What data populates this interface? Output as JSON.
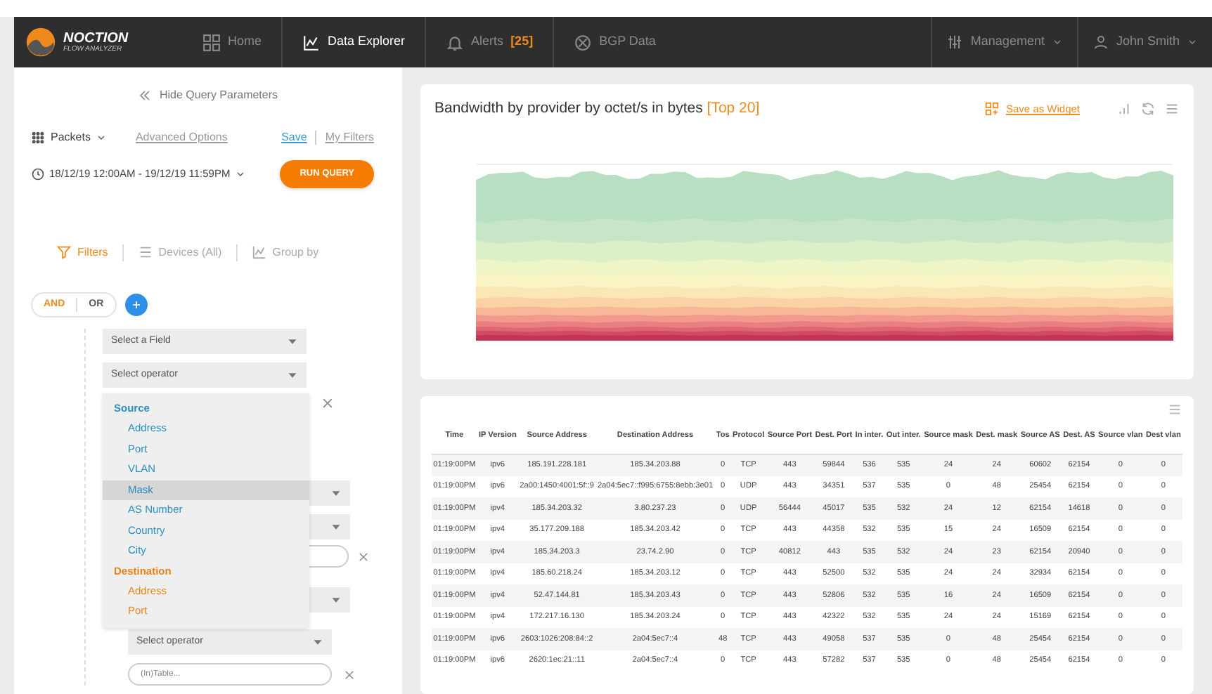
{
  "navbar": {
    "logo": {
      "name": "NOCTION",
      "subtitle": "FLOW ANALYZER"
    },
    "items": [
      {
        "label": "Home",
        "selected": false
      },
      {
        "label": "Data Explorer",
        "selected": true
      },
      {
        "label": "Alerts",
        "badge": "[25]",
        "selected": false
      },
      {
        "label": "BGP Data",
        "selected": false
      }
    ],
    "right": [
      {
        "label": "Management"
      },
      {
        "label": "John Smith"
      }
    ]
  },
  "query": {
    "hide_link": "Hide Query Parameters",
    "metric": "Packets",
    "advanced": "Advanced Options",
    "save": "Save",
    "my_filters": "My Filters",
    "range": "18/12/19 12:00AM - 19/12/19 11:59PM",
    "run": "RUN QUERY",
    "tabs": [
      {
        "label": "Filters",
        "selected": true
      },
      {
        "label": "Devices (All)",
        "selected": false
      },
      {
        "label": "Group by",
        "selected": false
      }
    ],
    "logic": [
      {
        "label": "AND",
        "selected": true
      },
      {
        "label": "OR",
        "selected": false
      }
    ],
    "field_select": {
      "placeholder": "Select a Field"
    },
    "operator_select": {
      "placeholder": "Select operator"
    },
    "dropdown": [
      {
        "group": "Source",
        "items": [
          {
            "label": "Address",
            "selected": false
          },
          {
            "label": "Port",
            "selected": false
          },
          {
            "label": "VLAN",
            "selected": false
          },
          {
            "label": "Mask",
            "selected": true
          },
          {
            "label": "AS Number",
            "selected": false
          },
          {
            "label": "Country",
            "selected": false
          },
          {
            "label": "City",
            "selected": false
          }
        ]
      },
      {
        "group": "Destination",
        "items": [
          {
            "label": "Address",
            "selected": false
          },
          {
            "label": "Port",
            "selected": false
          }
        ]
      }
    ],
    "lower_operator": {
      "placeholder": "Select operator"
    },
    "lower_value": {
      "placeholder": "(In)Table..."
    }
  },
  "chart": {
    "title": "Bandwidth by provider by octet/s in bytes",
    "title_badge": "[Top 20]",
    "save_widget": "Save as Widget"
  },
  "table": {
    "columns": [
      "Time",
      "IP Version",
      "Source Address",
      "Destination Address",
      "Tos",
      "Protocol",
      "Source Port",
      "Dest. Port",
      "In inter.",
      "Out inter.",
      "Source mask",
      "Dest. mask",
      "Source AS",
      "Dest. AS",
      "Source vlan",
      "Dest vlan"
    ],
    "rows": [
      [
        "01:19:00PM",
        "ipv6",
        "185.191.228.181",
        "185.34.203.88",
        "0",
        "TCP",
        "443",
        "59844",
        "536",
        "535",
        "24",
        "24",
        "60602",
        "62154",
        "0",
        "0"
      ],
      [
        "01:19:00PM",
        "ipv6",
        "2a00:1450:4001:5f::9",
        "2a04:5ec7::f995:6755:8ebb:3e01",
        "0",
        "UDP",
        "443",
        "34351",
        "537",
        "535",
        "0",
        "48",
        "25454",
        "62154",
        "0",
        "0"
      ],
      [
        "01:19:00PM",
        "ipv4",
        "185.34.203.32",
        "3.80.237.23",
        "0",
        "UDP",
        "56444",
        "45017",
        "535",
        "532",
        "24",
        "12",
        "62154",
        "14618",
        "0",
        "0"
      ],
      [
        "01:19:00PM",
        "ipv4",
        "35.177.209.188",
        "185.34.203.42",
        "0",
        "TCP",
        "443",
        "44358",
        "532",
        "535",
        "15",
        "24",
        "16509",
        "62154",
        "0",
        "0"
      ],
      [
        "01:19:00PM",
        "ipv4",
        "185.34.203.3",
        "23.74.2.90",
        "0",
        "TCP",
        "40812",
        "443",
        "535",
        "532",
        "24",
        "23",
        "62154",
        "20940",
        "0",
        "0"
      ],
      [
        "01:19:00PM",
        "ipv4",
        "185.60.218.24",
        "185.34.203.12",
        "0",
        "TCP",
        "443",
        "52500",
        "532",
        "535",
        "24",
        "24",
        "32934",
        "62154",
        "0",
        "0"
      ],
      [
        "01:19:00PM",
        "ipv4",
        "52.47.144.81",
        "185.34.203.43",
        "0",
        "TCP",
        "443",
        "52806",
        "532",
        "535",
        "16",
        "24",
        "16509",
        "62154",
        "0",
        "0"
      ],
      [
        "01:19:00PM",
        "ipv4",
        "172.217.16.130",
        "185.34.203.24",
        "0",
        "TCP",
        "443",
        "42322",
        "532",
        "535",
        "24",
        "24",
        "15169",
        "62154",
        "0",
        "0"
      ],
      [
        "01:19:00PM",
        "ipv6",
        "2603:1026:208:84::2",
        "2a04:5ec7::4",
        "48",
        "TCP",
        "443",
        "49058",
        "537",
        "535",
        "0",
        "48",
        "25454",
        "62154",
        "0",
        "0"
      ],
      [
        "01:19:00PM",
        "ipv6",
        "2620:1ec:21::11",
        "2a04:5ec7::4",
        "0",
        "TCP",
        "443",
        "57282",
        "537",
        "535",
        "0",
        "48",
        "25454",
        "62154",
        "0",
        "0"
      ]
    ]
  }
}
